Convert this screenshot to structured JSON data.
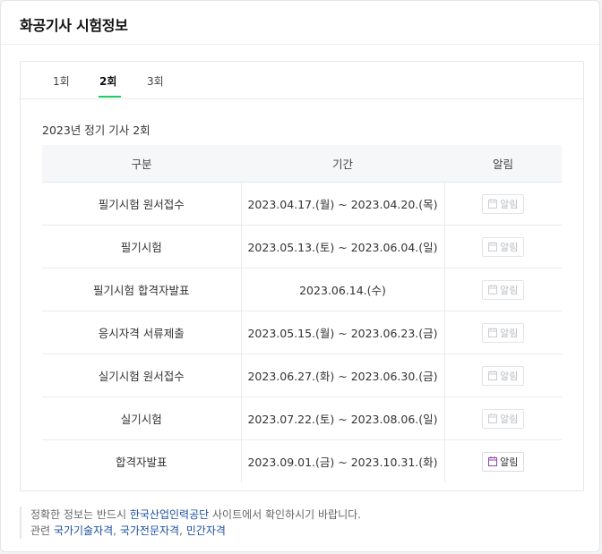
{
  "page": {
    "title": "화공기사 시험정보"
  },
  "tabs": [
    {
      "label": "1회",
      "active": false
    },
    {
      "label": "2회",
      "active": true
    },
    {
      "label": "3회",
      "active": false
    }
  ],
  "schedule": {
    "subtitle": "2023년 정기 기사 2회",
    "headers": {
      "category": "구분",
      "period": "기간",
      "alarm": "알림"
    },
    "rows": [
      {
        "category": "필기시험 원서접수",
        "period": "2023.04.17.(월) ~ 2023.04.20.(목)",
        "alarm_label": "알림",
        "alarm_enabled": false
      },
      {
        "category": "필기시험",
        "period": "2023.05.13.(토) ~ 2023.06.04.(일)",
        "alarm_label": "알림",
        "alarm_enabled": false
      },
      {
        "category": "필기시험 합격자발표",
        "period": "2023.06.14.(수)",
        "alarm_label": "알림",
        "alarm_enabled": false
      },
      {
        "category": "응시자격 서류제출",
        "period": "2023.05.15.(월) ~ 2023.06.23.(금)",
        "alarm_label": "알림",
        "alarm_enabled": false
      },
      {
        "category": "실기시험 원서접수",
        "period": "2023.06.27.(화) ~ 2023.06.30.(금)",
        "alarm_label": "알림",
        "alarm_enabled": false
      },
      {
        "category": "실기시험",
        "period": "2023.07.22.(토) ~ 2023.08.06.(일)",
        "alarm_label": "알림",
        "alarm_enabled": false
      },
      {
        "category": "합격자발표",
        "period": "2023.09.01.(금) ~ 2023.10.31.(화)",
        "alarm_label": "알림",
        "alarm_enabled": true
      }
    ]
  },
  "notice": {
    "line1_prefix": "정확한 정보는 반드시",
    "line1_link": "한국산업인력공단",
    "line1_suffix": "사이트에서 확인하시기 바랍니다.",
    "line2_prefix": "관련",
    "related_links": [
      "국가기술자격",
      "국가전문자격",
      "민간자격"
    ]
  },
  "colors": {
    "accent_green": "#19ce60",
    "link_blue": "#1a4fa0",
    "alarm_icon_active": "#8e44ad"
  },
  "icons": {
    "alarm": "calendar-icon"
  }
}
